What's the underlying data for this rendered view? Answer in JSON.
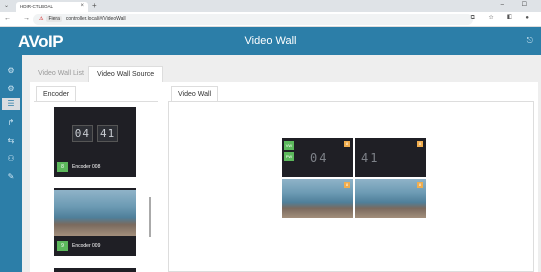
{
  "browser": {
    "tab_title": "HDIR-CTLBOAL",
    "tab_close": "×",
    "new_tab": "+",
    "window_buttons": "– ☐",
    "nav_buttons": "← → C",
    "url_warning": "⚠",
    "url_security": "Fiera",
    "url": "controller.local/#/VideoWall",
    "toolbar_icons": "⧉ ☆ ◧ ●"
  },
  "app": {
    "logo": "AVoIP",
    "title": "Video Wall",
    "logout_icon": "⎋"
  },
  "sidebar": {
    "icons": [
      "⚙",
      "⚙",
      "☰",
      "↱",
      "⇆",
      "⚇",
      "✎"
    ]
  },
  "tabs": {
    "list": "Video Wall List",
    "source": "Video Wall Source"
  },
  "encoder_panel": {
    "tab": "Encoder",
    "cards": [
      {
        "type": "clock",
        "clock_h": "04",
        "clock_m": "41",
        "num": "8",
        "name": "Encoder 008"
      },
      {
        "type": "image",
        "num": "9",
        "name": "Encoder 009"
      }
    ]
  },
  "videowall": {
    "tab": "Video Wall",
    "clock_h": "04",
    "clock_m": "41",
    "source_badges": [
      "VW",
      "PW"
    ],
    "cell_badge": "8"
  },
  "colors": {
    "header": "#2c7ea8",
    "badge_green": "#5cb85c",
    "badge_orange": "#f0ad4e"
  }
}
